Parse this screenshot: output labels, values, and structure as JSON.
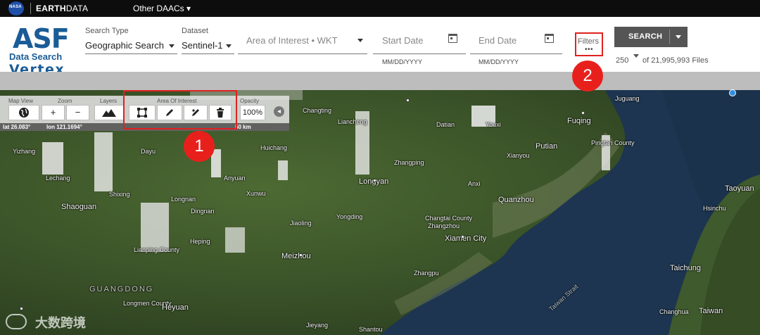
{
  "topbar": {
    "nasa_logo_text": "NASA",
    "brand_bold": "EARTH",
    "brand_rest": "DATA",
    "daacs_label": "Other DAACs",
    "daacs_caret": "▾"
  },
  "logo": {
    "asf": "ASF",
    "data_search": "Data Search",
    "vertex": "Vertex",
    "color": "#1a5c96"
  },
  "search": {
    "search_type_label": "Search Type",
    "search_type_value": "Geographic Search",
    "dataset_label": "Dataset",
    "dataset_value": "Sentinel-1",
    "aoi_placeholder": "Area of Interest • WKT",
    "start_date_placeholder": "Start Date",
    "start_date_hint": "MM/DD/YYYY",
    "end_date_placeholder": "End Date",
    "end_date_hint": "MM/DD/YYYY",
    "filters_label": "Filters",
    "filters_dots": "•••",
    "search_button": "SEARCH",
    "max_results": "250",
    "file_count": "of 21,995,993 Files"
  },
  "toolbar": {
    "map_view_label": "Map View",
    "zoom_label": "Zoom",
    "layers_label": "Layers",
    "aoi_label": "Area Of Interest",
    "opacity_label": "Opacity",
    "zoom_in": "+",
    "zoom_out": "−",
    "opacity_value": "100%",
    "collapse_icon": "◂",
    "lat": "lat 26.083°",
    "lon": "lon 121.1694°",
    "scale": "50 km"
  },
  "callouts": [
    "1",
    "2"
  ],
  "map_labels": {
    "changting": "Changting",
    "liancheng": "Liancheng",
    "datian": "Datian",
    "youxi": "Youxi",
    "jugang": "Juguang",
    "fuqing": "Fuqing",
    "pingtan": "Pingtan County",
    "yizhang": "Yizhang",
    "dayu": "Dayu",
    "huichang": "Huichang",
    "xianyou": "Xianyou",
    "putian": "Putian",
    "lechang": "Lechang",
    "zhangping": "Zhangping",
    "anyuan": "Anyuan",
    "shixing": "Shixing",
    "xunwu": "Xunwu",
    "longyan": "Longyan",
    "anxi": "Anxi",
    "taoyuan": "Taoyuan",
    "shaoguan": "Shaoguan",
    "longnan": "Longnan",
    "dingnan": "Dingnan",
    "quanzhou": "Quanzhou",
    "hsinchu": "Hsinchu",
    "jiaoling": "Jiaoling",
    "yongding": "Yongding",
    "changtai": "Changtai County",
    "zhangzhou": "Zhangzhou",
    "xiamen": "Xiamen City",
    "lianping": "Lianping County",
    "heping": "Heping",
    "meizhou": "Meizhou",
    "zhangpu": "Zhangpu",
    "taichung": "Taichung",
    "guangdong": "GUANGDONG",
    "taiwan_strait": "Taiwan Strait",
    "longmen": "Longmen County",
    "heyuan": "Heyuan",
    "changhua": "Changhua",
    "taiwan": "Taiwan",
    "jieyang": "Jieyang",
    "shantou": "Shantou"
  },
  "watermark": "大数跨境"
}
